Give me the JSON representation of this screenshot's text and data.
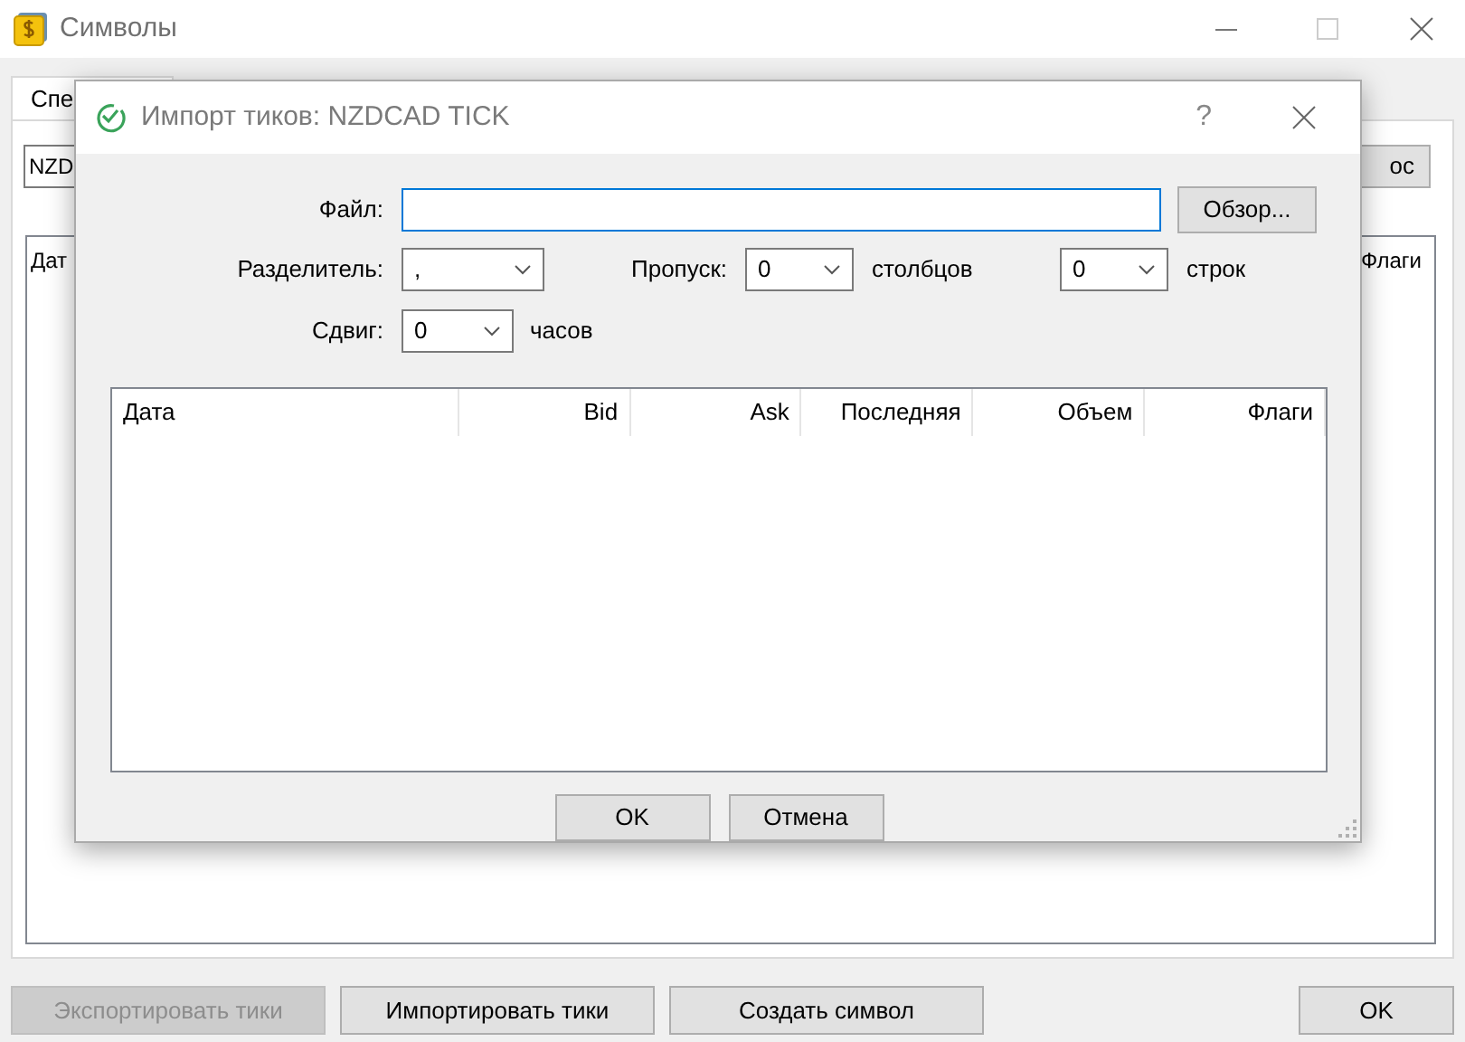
{
  "window": {
    "title": "Символы"
  },
  "tabs": [
    {
      "label": "Спе",
      "selected": true
    }
  ],
  "symbol_field": {
    "value": "NZD"
  },
  "side_button": {
    "label": "ос"
  },
  "background_table": {
    "columns": [
      "Дат",
      "Флаги"
    ]
  },
  "bottom_buttons": [
    {
      "label": "Экспортировать тики",
      "disabled": true
    },
    {
      "label": "Импортировать тики",
      "disabled": false
    },
    {
      "label": "Создать символ",
      "disabled": false
    }
  ],
  "ok_button": {
    "label": "OK"
  },
  "dialog": {
    "title": "Импорт тиков: NZDCAD TICK",
    "help": "?",
    "file": {
      "label": "Файл:"
    },
    "browse_button": "Обзор...",
    "separator": {
      "label": "Разделитель:",
      "value": ","
    },
    "skip": {
      "label": "Пропуск:",
      "columns_value": "0",
      "columns_unit": "столбцов",
      "rows_value": "0",
      "rows_unit": "строк"
    },
    "shift": {
      "label": "Сдвиг:",
      "value": "0",
      "unit": "часов"
    },
    "table": {
      "columns": [
        "Дата",
        "Bid",
        "Ask",
        "Последняя",
        "Объем",
        "Флаги"
      ]
    },
    "buttons": [
      "OK",
      "Отмена"
    ]
  }
}
